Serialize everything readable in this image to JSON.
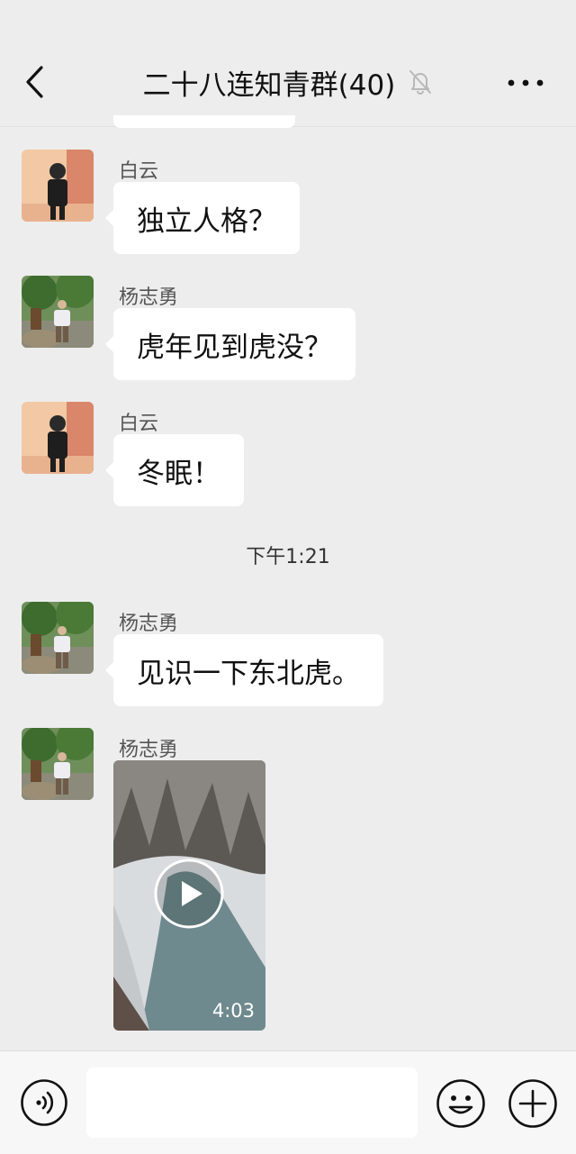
{
  "header": {
    "title": "二十八连知青群(40)",
    "back_icon": "chevron-left-icon",
    "mute_icon": "bell-off-icon",
    "more_icon": "more-horizontal-icon"
  },
  "messages": [
    {
      "sender": "白云",
      "text": "独立人格？",
      "avatar": "person-avatar"
    },
    {
      "sender": "杨志勇",
      "text": "虎年见到虎没？",
      "avatar": "person-avatar"
    },
    {
      "sender": "白云",
      "text": "冬眠！",
      "avatar": "person-avatar"
    },
    {
      "timestamp": "下午1:21"
    },
    {
      "sender": "杨志勇",
      "text": "见识一下东北虎。",
      "avatar": "person-avatar"
    },
    {
      "sender": "杨志勇",
      "video": {
        "duration": "4:03",
        "icon": "play-icon"
      },
      "avatar": "person-avatar"
    }
  ],
  "input_bar": {
    "voice_icon": "voice-icon",
    "input_value": "",
    "emoji_icon": "emoji-icon",
    "plus_icon": "plus-circle-icon"
  },
  "colors": {
    "background": "#EDEDED",
    "bubble": "#FFFFFF",
    "text": "#111111",
    "secondary_text": "#555555"
  }
}
